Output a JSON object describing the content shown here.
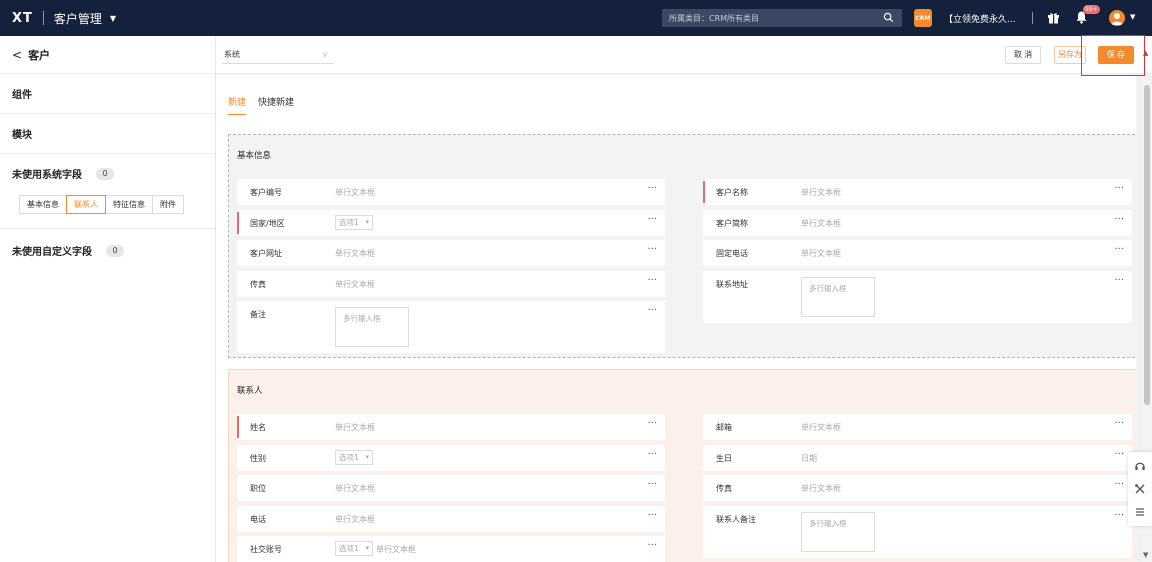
{
  "topbar": {
    "logo": "XT",
    "app_title": "客户管理",
    "search_placeholder": "所属类目：CRM所有类目",
    "crm_badge": "CRM",
    "promo_text": "【立领免费永久...",
    "notification_count": "99+"
  },
  "sidebar": {
    "back_title": "客户",
    "sections": [
      "组件",
      "模块"
    ],
    "unused_system": {
      "title": "未使用系统字段",
      "count": "0"
    },
    "mini_tabs": [
      "基本信息",
      "联系人",
      "特征信息",
      "附件"
    ],
    "mini_tab_active": 1,
    "unused_custom": {
      "title": "未使用自定义字段",
      "count": "0"
    }
  },
  "header": {
    "system_select": "系统",
    "cancel_label": "取 消",
    "saveas_label": "另存为",
    "save_label": "保 存"
  },
  "tabs": [
    "新建",
    "快捷新建"
  ],
  "groups": {
    "basic": {
      "title": "基本信息",
      "left": [
        {
          "label": "客户编号",
          "value": "单行文本框",
          "kind": "text",
          "required": false
        },
        {
          "label": "国家/地区",
          "value": "选项1",
          "kind": "select",
          "required": true
        },
        {
          "label": "客户网址",
          "value": "单行文本框",
          "kind": "text",
          "required": false
        },
        {
          "label": "传真",
          "value": "单行文本框",
          "kind": "text",
          "required": false
        },
        {
          "label": "备注",
          "value": "多行输入框",
          "kind": "textarea",
          "required": false
        }
      ],
      "right": [
        {
          "label": "客户名称",
          "value": "单行文本框",
          "kind": "text",
          "required": true
        },
        {
          "label": "客户简称",
          "value": "单行文本框",
          "kind": "text",
          "required": false
        },
        {
          "label": "固定电话",
          "value": "单行文本框",
          "kind": "text",
          "required": false
        },
        {
          "label": "联系地址",
          "value": "多行输入框",
          "kind": "textarea",
          "required": false
        }
      ]
    },
    "contact": {
      "title": "联系人",
      "left": [
        {
          "label": "姓名",
          "value": "单行文本框",
          "kind": "text",
          "required": true
        },
        {
          "label": "性别",
          "value": "选项1",
          "kind": "select",
          "required": false
        },
        {
          "label": "职位",
          "value": "单行文本框",
          "kind": "text",
          "required": false
        },
        {
          "label": "电话",
          "value": "单行文本框",
          "kind": "text",
          "required": false
        },
        {
          "label": "社交账号",
          "value": "选项1",
          "kind": "select",
          "extra": "单行文本框",
          "required": false
        }
      ],
      "right": [
        {
          "label": "邮箱",
          "value": "单行文本框",
          "kind": "text",
          "required": false
        },
        {
          "label": "生日",
          "value": "日期",
          "kind": "text",
          "required": false
        },
        {
          "label": "传真",
          "value": "单行文本框",
          "kind": "text",
          "required": false
        },
        {
          "label": "联系人备注",
          "value": "多行输入框",
          "kind": "textarea",
          "required": false
        }
      ]
    }
  },
  "more_glyph": "···",
  "colors": {
    "accent": "#f58a2d",
    "topbar": "#14213d",
    "required": "#e56b6b",
    "highlight": "#e03131"
  }
}
